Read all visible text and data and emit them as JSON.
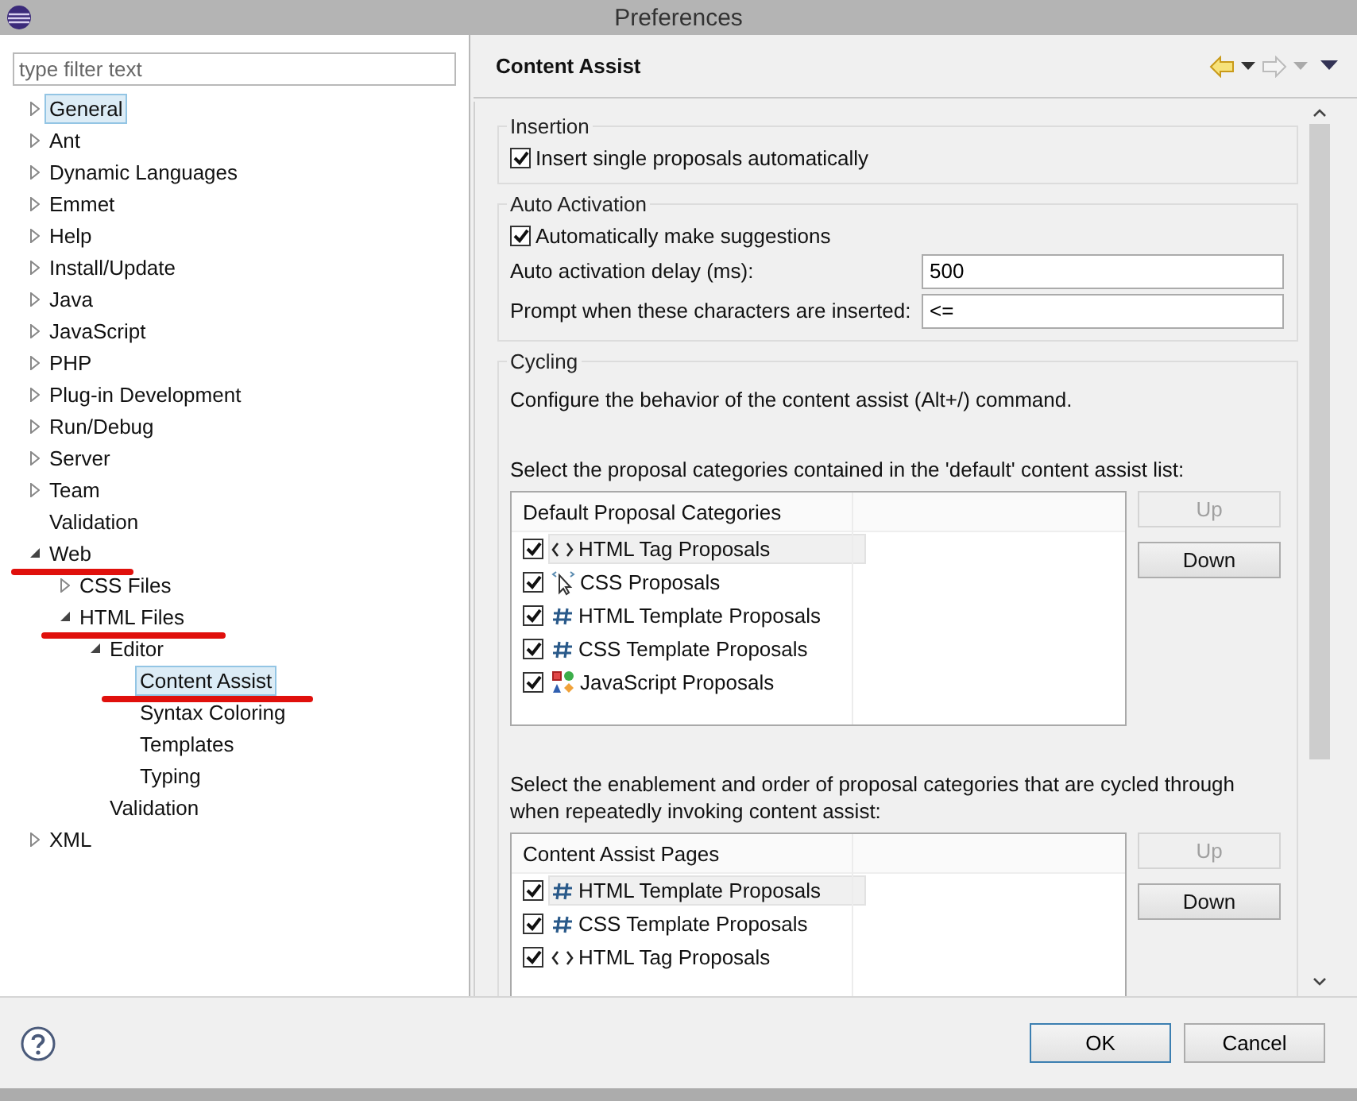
{
  "window": {
    "title": "Preferences"
  },
  "filter": {
    "placeholder": "type filter text"
  },
  "tree": [
    {
      "label": "General",
      "expanded": false,
      "selected": true,
      "underlined": false
    },
    {
      "label": "Ant",
      "expanded": false,
      "selected": false,
      "underlined": false
    },
    {
      "label": "Dynamic Languages",
      "expanded": false,
      "selected": false,
      "underlined": false
    },
    {
      "label": "Emmet",
      "expanded": false,
      "selected": false,
      "underlined": false
    },
    {
      "label": "Help",
      "expanded": false,
      "selected": false,
      "underlined": false
    },
    {
      "label": "Install/Update",
      "expanded": false,
      "selected": false,
      "underlined": false
    },
    {
      "label": "Java",
      "expanded": false,
      "selected": false,
      "underlined": false
    },
    {
      "label": "JavaScript",
      "expanded": false,
      "selected": false,
      "underlined": false
    },
    {
      "label": "PHP",
      "expanded": false,
      "selected": false,
      "underlined": false
    },
    {
      "label": "Plug-in Development",
      "expanded": false,
      "selected": false,
      "underlined": false
    },
    {
      "label": "Run/Debug",
      "expanded": false,
      "selected": false,
      "underlined": false
    },
    {
      "label": "Server",
      "expanded": false,
      "selected": false,
      "underlined": false
    },
    {
      "label": "Team",
      "expanded": false,
      "selected": false,
      "underlined": false
    },
    {
      "label": "Validation",
      "selected": false,
      "underlined": false
    },
    {
      "label": "Web",
      "expanded": true,
      "selected": false,
      "underlined": true,
      "children": [
        {
          "label": "CSS Files",
          "expanded": false,
          "selected": false,
          "underlined": false
        },
        {
          "label": "HTML Files",
          "expanded": true,
          "selected": false,
          "underlined": true,
          "children": [
            {
              "label": "Editor",
              "expanded": true,
              "selected": false,
              "underlined": false,
              "children": [
                {
                  "label": "Content Assist",
                  "selected": true,
                  "underlined": true
                },
                {
                  "label": "Syntax Coloring",
                  "selected": false,
                  "underlined": false
                },
                {
                  "label": "Templates",
                  "selected": false,
                  "underlined": false
                },
                {
                  "label": "Typing",
                  "selected": false,
                  "underlined": false
                }
              ]
            },
            {
              "label": "Validation",
              "selected": false,
              "underlined": false
            }
          ]
        }
      ]
    },
    {
      "label": "XML",
      "expanded": false,
      "selected": false,
      "underlined": false
    }
  ],
  "page": {
    "title": "Content Assist",
    "insertion": {
      "title": "Insertion",
      "options": [
        {
          "label": "Insert single proposals automatically",
          "checked": true
        }
      ]
    },
    "auto_activation": {
      "title": "Auto Activation",
      "options": [
        {
          "label": "Automatically make suggestions",
          "checked": true
        }
      ],
      "fields": [
        {
          "label": "Auto activation delay (ms):",
          "value": "500"
        },
        {
          "label": "Prompt when these characters are inserted:",
          "value": "<="
        }
      ]
    },
    "cycling": {
      "title": "Cycling",
      "description": "Configure the behavior of the content assist (Alt+/) command.",
      "lists": [
        {
          "label": "Select the proposal categories contained in the 'default' content assist list:",
          "header": "Default Proposal Categories",
          "items": [
            {
              "label": "HTML Tag Proposals",
              "kind": "tag",
              "checked": true,
              "selected": true
            },
            {
              "label": "CSS Proposals",
              "kind": "css",
              "checked": true,
              "selected": false
            },
            {
              "label": "HTML Template Proposals",
              "kind": "template",
              "checked": true,
              "selected": false
            },
            {
              "label": "CSS Template Proposals",
              "kind": "template",
              "checked": true,
              "selected": false
            },
            {
              "label": "JavaScript Proposals",
              "kind": "js",
              "checked": true,
              "selected": false
            }
          ],
          "buttons": [
            {
              "label": "Up",
              "disabled": true
            },
            {
              "label": "Down",
              "disabled": false
            }
          ]
        },
        {
          "label": "Select the enablement and order of proposal categories that are cycled through when repeatedly invoking content assist:",
          "header": "Content Assist Pages",
          "items": [
            {
              "label": "HTML Template Proposals",
              "kind": "template",
              "checked": true,
              "selected": true
            },
            {
              "label": "CSS Template Proposals",
              "kind": "template",
              "checked": true,
              "selected": false
            },
            {
              "label": "HTML Tag Proposals",
              "kind": "tag",
              "checked": true,
              "selected": false
            }
          ],
          "buttons": [
            {
              "label": "Up",
              "disabled": true
            },
            {
              "label": "Down",
              "disabled": false
            }
          ]
        }
      ]
    }
  },
  "buttons": [
    {
      "label": "OK",
      "default": true
    },
    {
      "label": "Cancel",
      "default": false
    }
  ]
}
